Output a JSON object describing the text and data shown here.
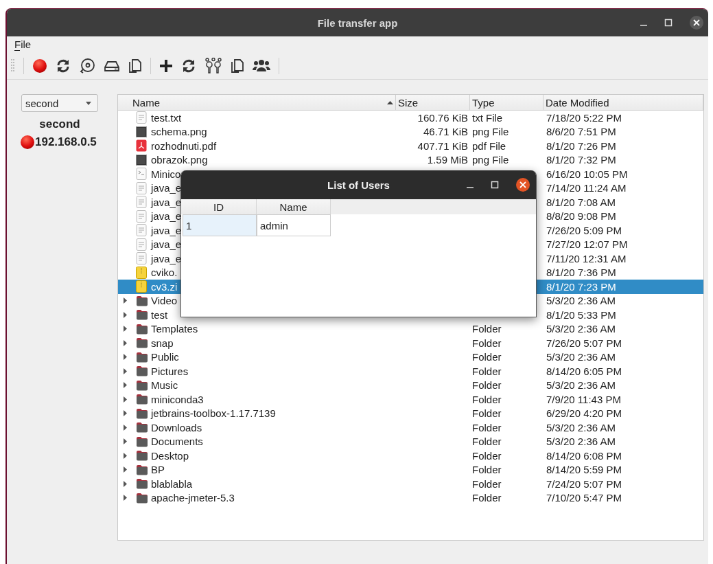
{
  "window": {
    "title": "File transfer app"
  },
  "menu": [
    "File"
  ],
  "sidebar": {
    "server_select": "second",
    "server_name": "second",
    "address": "192.168.0.5"
  },
  "file_table": {
    "columns": [
      {
        "label": "Name",
        "sorted": true
      },
      {
        "label": "Size",
        "sorted": false
      },
      {
        "label": "Type",
        "sorted": false
      },
      {
        "label": "Date Modified",
        "sorted": false
      }
    ],
    "rows": [
      {
        "name": "test.txt",
        "size": "160.76 KiB",
        "type": "txt File",
        "date": "7/18/20 5:22 PM",
        "kind": "text",
        "selected": false
      },
      {
        "name": "schema.png",
        "size": "46.71 KiB",
        "type": "png File",
        "date": "8/6/20 7:51 PM",
        "kind": "image",
        "selected": false
      },
      {
        "name": "rozhodnuti.pdf",
        "size": "407.71 KiB",
        "type": "pdf File",
        "date": "8/1/20 7:26 PM",
        "kind": "pdf",
        "selected": false
      },
      {
        "name": "obrazok.png",
        "size": "1.59 MiB",
        "type": "png File",
        "date": "8/1/20 7:32 PM",
        "kind": "image",
        "selected": false
      },
      {
        "name": "Minico",
        "date": "6/16/20 10:05 PM",
        "kind": "script",
        "selected": false
      },
      {
        "name": "java_e",
        "date": "7/14/20 11:24 AM",
        "kind": "text",
        "selected": false
      },
      {
        "name": "java_e",
        "date": "8/1/20 7:08 AM",
        "kind": "text",
        "selected": false
      },
      {
        "name": "java_e",
        "date": "8/8/20 9:08 PM",
        "kind": "text",
        "selected": false
      },
      {
        "name": "java_e",
        "date": "7/26/20 5:09 PM",
        "kind": "text",
        "selected": false
      },
      {
        "name": "java_e",
        "date": "7/27/20 12:07 PM",
        "kind": "text",
        "selected": false
      },
      {
        "name": "java_e",
        "date": "7/11/20 12:31 AM",
        "kind": "text",
        "selected": false
      },
      {
        "name": "cviko.",
        "date": "8/1/20 7:36 PM",
        "kind": "zip",
        "selected": false
      },
      {
        "name": "cv3.zi",
        "date": "8/1/20 7:23 PM",
        "kind": "zip",
        "selected": true
      },
      {
        "name": "Video",
        "date": "5/3/20 2:36 AM",
        "kind": "folder",
        "selected": false
      },
      {
        "name": "test",
        "date": "8/1/20 5:33 PM",
        "kind": "folder",
        "selected": false
      },
      {
        "name": "Templates",
        "type": "Folder",
        "date": "5/3/20 2:36 AM",
        "kind": "folder",
        "selected": false
      },
      {
        "name": "snap",
        "type": "Folder",
        "date": "7/26/20 5:07 PM",
        "kind": "folder",
        "selected": false
      },
      {
        "name": "Public",
        "type": "Folder",
        "date": "5/3/20 2:36 AM",
        "kind": "folder",
        "selected": false
      },
      {
        "name": "Pictures",
        "type": "Folder",
        "date": "8/14/20 6:05 PM",
        "kind": "folder",
        "selected": false
      },
      {
        "name": "Music",
        "type": "Folder",
        "date": "5/3/20 2:36 AM",
        "kind": "folder",
        "selected": false
      },
      {
        "name": "miniconda3",
        "type": "Folder",
        "date": "7/9/20 11:43 PM",
        "kind": "folder",
        "selected": false
      },
      {
        "name": "jetbrains-toolbox-1.17.7139",
        "type": "Folder",
        "date": "6/29/20 4:20 PM",
        "kind": "folder",
        "selected": false
      },
      {
        "name": "Downloads",
        "type": "Folder",
        "date": "5/3/20 2:36 AM",
        "kind": "folder",
        "selected": false
      },
      {
        "name": "Documents",
        "type": "Folder",
        "date": "5/3/20 2:36 AM",
        "kind": "folder",
        "selected": false
      },
      {
        "name": "Desktop",
        "type": "Folder",
        "date": "8/14/20 6:08 PM",
        "kind": "folder",
        "selected": false
      },
      {
        "name": "BP",
        "type": "Folder",
        "date": "8/14/20 5:59 PM",
        "kind": "folder",
        "selected": false
      },
      {
        "name": "blablabla",
        "type": "Folder",
        "date": "7/24/20 5:07 PM",
        "kind": "folder",
        "selected": false
      },
      {
        "name": "apache-jmeter-5.3",
        "type": "Folder",
        "date": "7/10/20 5:47 PM",
        "kind": "folder",
        "selected": false
      }
    ]
  },
  "dialog": {
    "title": "List of Users",
    "columns": [
      "ID",
      "Name"
    ],
    "rows": [
      [
        {
          "text": "1",
          "selected": true
        },
        {
          "text": "admin",
          "selected": false
        }
      ]
    ]
  }
}
